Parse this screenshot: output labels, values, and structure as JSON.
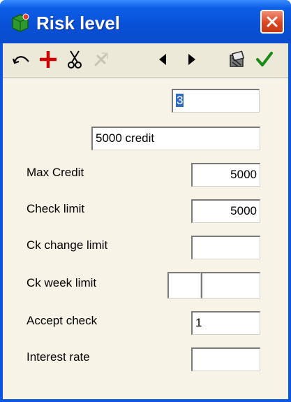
{
  "window": {
    "title": "Risk level"
  },
  "toolbar": {
    "buttons": [
      {
        "icon": "undo-icon"
      },
      {
        "icon": "add-icon"
      },
      {
        "icon": "cut-icon"
      },
      {
        "icon": "delete-icon"
      },
      {
        "icon": "previous-icon"
      },
      {
        "icon": "next-icon"
      },
      {
        "icon": "report-icon"
      },
      {
        "icon": "confirm-icon"
      }
    ]
  },
  "form": {
    "code": "3",
    "description": "5000 credit",
    "max_credit": {
      "label": "Max Credit",
      "value": "5000"
    },
    "check_limit": {
      "label": "Check limit",
      "value": "5000"
    },
    "ck_change_limit": {
      "label": "Ck change limit",
      "value": ""
    },
    "ck_week_limit": {
      "label": "Ck week limit",
      "value1": "",
      "value2": ""
    },
    "accept_check": {
      "label": "Accept check",
      "value": "1"
    },
    "interest_rate": {
      "label": "Interest rate",
      "value": ""
    }
  },
  "colors": {
    "title_bar": "#0a56e0",
    "client_bg": "#ece9d8",
    "add_red": "#d10000",
    "confirm_green": "#1a8a1a",
    "selection": "#316ac5"
  }
}
